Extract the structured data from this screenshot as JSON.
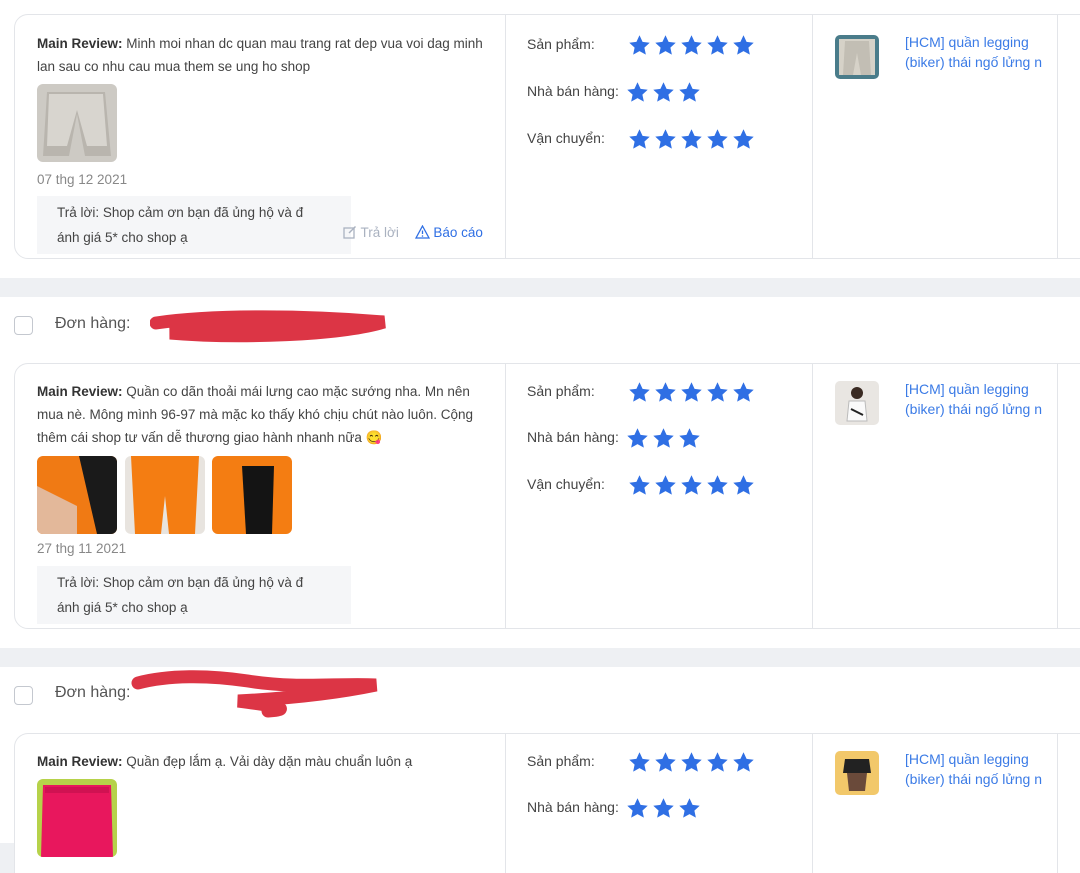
{
  "accent_color": "#2f6fe4",
  "star_color": "#2f6fe4",
  "order_label": "Đơn hàng:",
  "rating_labels": {
    "product": "Sản phẩm:",
    "seller": "Nhà bán hàng:",
    "shipping": "Vận chuyển:"
  },
  "actions": {
    "reply": "Trả lời",
    "report": "Báo cáo"
  },
  "reviews": [
    {
      "main_label": "Main Review:",
      "text": "Minh moi nhan dc quan mau trang rat dep vua voi dag minh lan sau co nhu cau mua them se ung ho shop",
      "date": "07 thg 12 2021",
      "reply": "Trả lời: Shop cảm ơn bạn đã ủng hộ và đánh giá 5* cho shop ạ",
      "reply_line1": "Trả lời: Shop cảm ơn bạn đã ủng hộ và đ",
      "reply_line2": "ánh giá 5* cho shop ạ",
      "ratings": {
        "product": 5,
        "seller": 3,
        "shipping": 5
      },
      "product_name_line1": "[HCM] quần legging",
      "product_name_line2": "(biker) thái ngố lửng n"
    },
    {
      "main_label": "Main Review:",
      "text": "Quần co dãn thoải mái lưng cao mặc sướng nha. Mn nên mua nè. Mông mình 96-97 mà mặc ko thấy khó chịu chút nào luôn. Cộng thêm cái shop tư vấn dễ thương giao hành nhanh nữa 😋",
      "date": "27 thg 11 2021",
      "reply_line1": "Trả lời: Shop cảm ơn bạn đã ủng hộ và đ",
      "reply_line2": "ánh giá 5* cho shop ạ",
      "ratings": {
        "product": 5,
        "seller": 3,
        "shipping": 5
      },
      "product_name_line1": "[HCM] quần legging",
      "product_name_line2": "(biker) thái ngố lửng n"
    },
    {
      "main_label": "Main Review:",
      "text": "Quần đẹp lắm ạ. Vải dày dặn màu chuẩn luôn ạ",
      "ratings": {
        "product": 5,
        "seller": 3
      },
      "product_name_line1": "[HCM] quần legging",
      "product_name_line2": "(biker) thái ngố lửng n"
    }
  ]
}
